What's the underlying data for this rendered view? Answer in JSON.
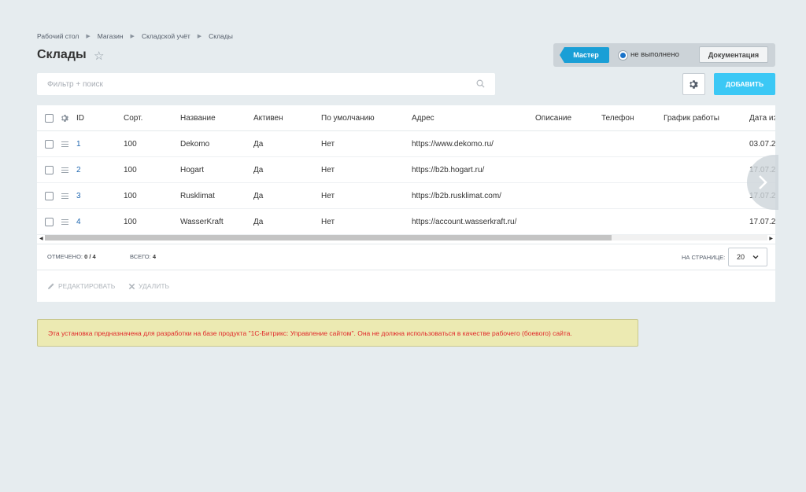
{
  "breadcrumb": [
    "Рабочий стол",
    "Магазин",
    "Складской учёт",
    "Склады"
  ],
  "page": {
    "title": "Склады"
  },
  "master": {
    "button_label": "Мастер",
    "status": "не выполнено",
    "doc_label": "Документация"
  },
  "filter": {
    "placeholder": "Фильтр + поиск"
  },
  "toolbar": {
    "add_label": "ДОБАВИТЬ"
  },
  "table": {
    "columns": {
      "id": "ID",
      "sort": "Сорт.",
      "name": "Название",
      "active": "Активен",
      "default": "По умолчанию",
      "address": "Адрес",
      "description": "Описание",
      "phone": "Телефон",
      "schedule": "График работы",
      "date": "Дата из"
    },
    "rows": [
      {
        "id": "1",
        "sort": "100",
        "name": "Dekomo",
        "active": "Да",
        "default": "Нет",
        "address": "https://www.dekomo.ru/",
        "date": "03.07.2"
      },
      {
        "id": "2",
        "sort": "100",
        "name": "Hogart",
        "active": "Да",
        "default": "Нет",
        "address": "https://b2b.hogart.ru/",
        "date": "17.07.2"
      },
      {
        "id": "3",
        "sort": "100",
        "name": "Rusklimat",
        "active": "Да",
        "default": "Нет",
        "address": "https://b2b.rusklimat.com/",
        "date": "17.07.2"
      },
      {
        "id": "4",
        "sort": "100",
        "name": "WasserKraft",
        "active": "Да",
        "default": "Нет",
        "address": "https://account.wasserkraft.ru/",
        "date": "17.07.2"
      }
    ]
  },
  "footer": {
    "selected_label": "ОТМЕЧЕНО:",
    "selected_value": "0 / 4",
    "total_label": "ВСЕГО:",
    "total_value": "4",
    "per_page_label": "НА СТРАНИЦЕ:",
    "per_page_value": "20"
  },
  "actions": {
    "edit_label": "РЕДАКТИРОВАТЬ",
    "delete_label": "УДАЛИТЬ"
  },
  "warning": {
    "text": "Эта установка предназначена для разработки на базе продукта \"1С-Битрикс: Управление сайтом\". Она не должна использоваться в качестве рабочего (боевого) сайта."
  }
}
